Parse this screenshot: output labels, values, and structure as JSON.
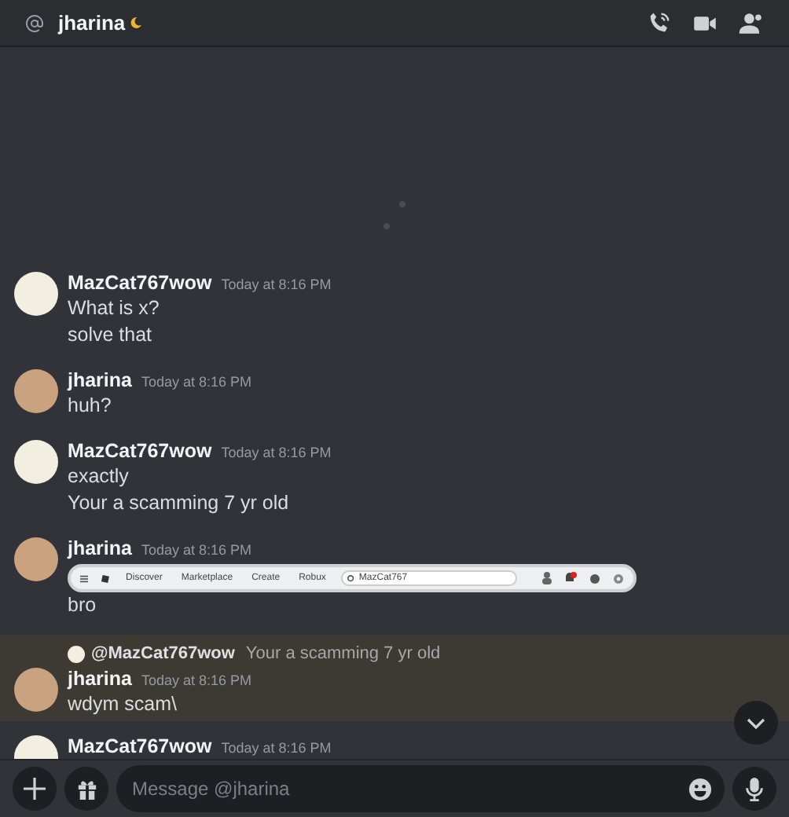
{
  "header": {
    "channel_name": "jharina"
  },
  "messages": [
    {
      "author": "MazCat767wow",
      "timestamp": "Today at 8:16 PM",
      "color": "#f3efe0",
      "highlighted": false,
      "lines": [
        "What is x?",
        "solve that"
      ]
    },
    {
      "author": "jharina",
      "timestamp": "Today at 8:16 PM",
      "color": "#c9a27f",
      "highlighted": false,
      "lines": [
        "huh?"
      ]
    },
    {
      "author": "MazCat767wow",
      "timestamp": "Today at 8:16 PM",
      "color": "#f3efe0",
      "highlighted": false,
      "lines": [
        "exactly",
        "Your a scamming 7 yr old"
      ]
    },
    {
      "author": "jharina",
      "timestamp": "Today at 8:16 PM",
      "color": "#c9a27f",
      "highlighted": false,
      "attachment": {
        "kind": "screenshot",
        "nav_items": [
          "Discover",
          "Marketplace",
          "Create",
          "Robux"
        ],
        "search_value": "MazCat767"
      },
      "lines": [
        "bro"
      ]
    },
    {
      "author": "jharina",
      "timestamp": "Today at 8:16 PM",
      "color": "#c9a27f",
      "highlighted": true,
      "reply_to": {
        "author": "@MazCat767wow",
        "text": "Your a scamming 7 yr old",
        "color": "#f3efe0"
      },
      "lines": [
        "wdym scam\\"
      ]
    },
    {
      "author": "MazCat767wow",
      "timestamp": "Today at 8:16 PM",
      "color": "#f3efe0",
      "highlighted": false
    }
  ],
  "composer": {
    "placeholder": "Message @jharina"
  }
}
